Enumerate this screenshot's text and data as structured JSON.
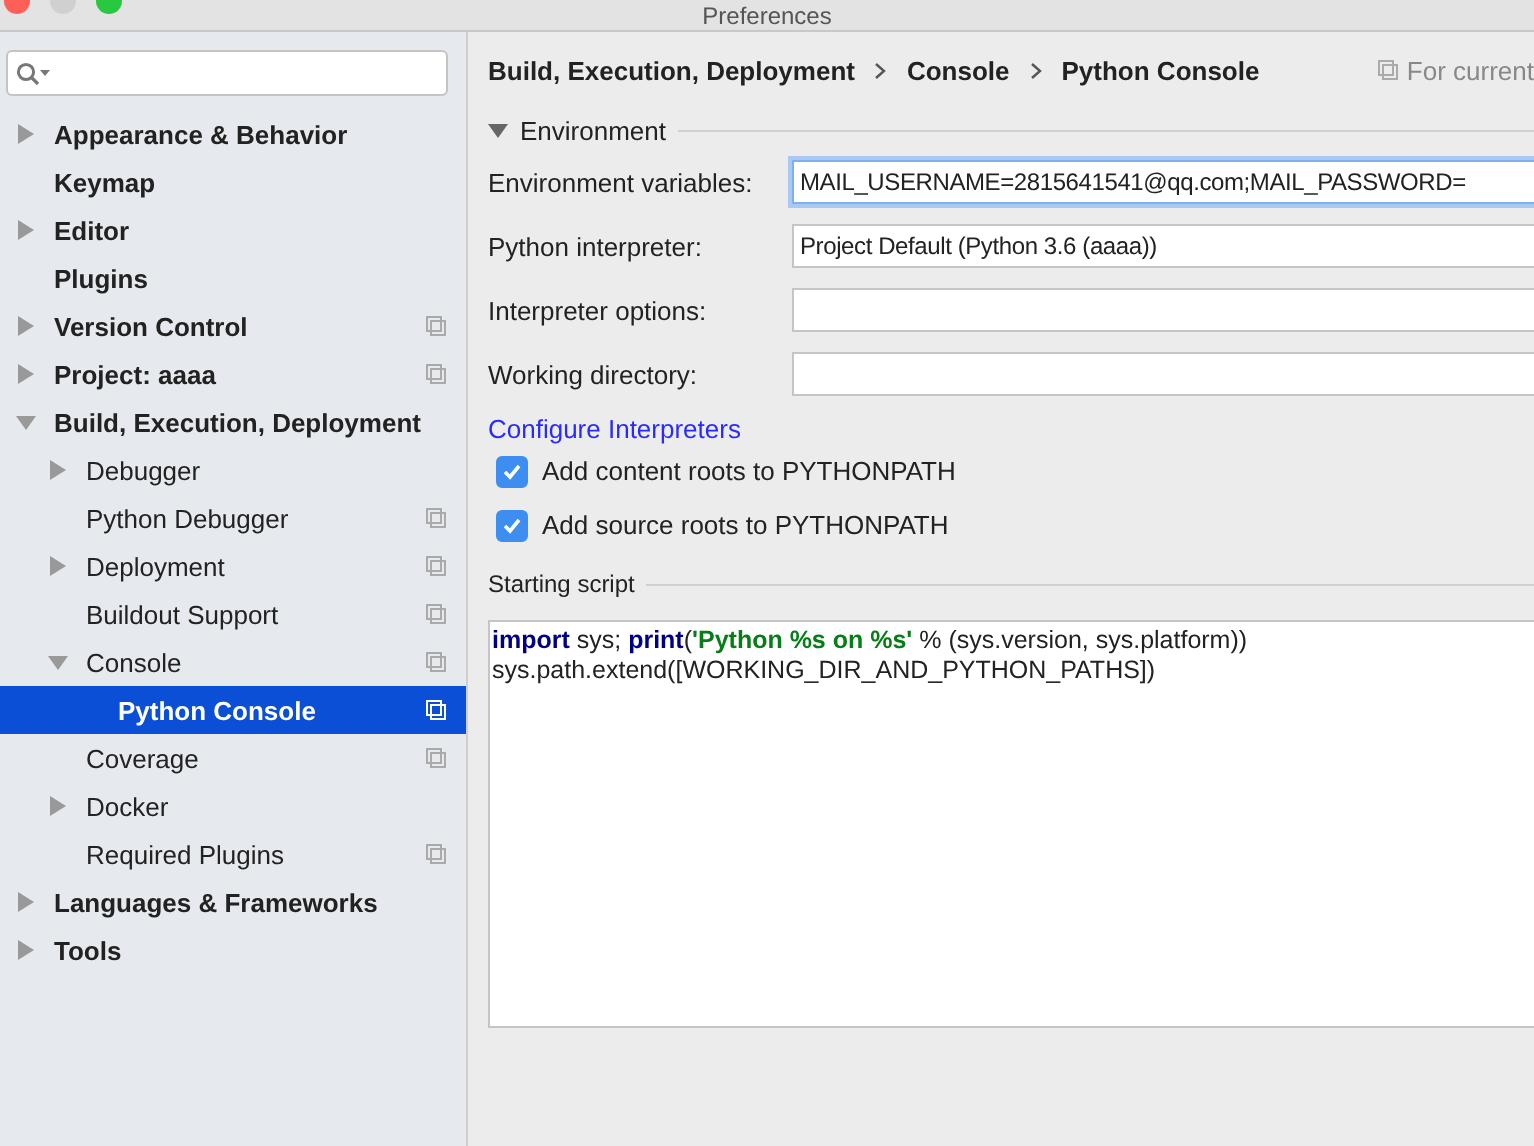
{
  "window": {
    "title": "Preferences"
  },
  "sidebar": {
    "items": [
      {
        "label": "Appearance & Behavior",
        "kind": "folder",
        "expanded": false,
        "selected": false,
        "project_level": false
      },
      {
        "label": "Keymap",
        "kind": "leaf",
        "selected": false,
        "project_level": false
      },
      {
        "label": "Editor",
        "kind": "folder",
        "expanded": false,
        "selected": false,
        "project_level": false
      },
      {
        "label": "Plugins",
        "kind": "leaf",
        "selected": false,
        "project_level": false
      },
      {
        "label": "Version Control",
        "kind": "folder",
        "expanded": false,
        "selected": false,
        "project_level": true
      },
      {
        "label": "Project: aaaa",
        "kind": "folder",
        "expanded": false,
        "selected": false,
        "project_level": true
      },
      {
        "label": "Build, Execution, Deployment",
        "kind": "folder",
        "expanded": true,
        "selected": false,
        "project_level": false,
        "children": [
          {
            "label": "Debugger",
            "kind": "folder",
            "expanded": false,
            "selected": false,
            "project_level": false
          },
          {
            "label": "Python Debugger",
            "kind": "leaf",
            "selected": false,
            "project_level": true
          },
          {
            "label": "Deployment",
            "kind": "folder",
            "expanded": false,
            "selected": false,
            "project_level": true
          },
          {
            "label": "Buildout Support",
            "kind": "leaf",
            "selected": false,
            "project_level": true
          },
          {
            "label": "Console",
            "kind": "folder",
            "expanded": true,
            "selected": false,
            "project_level": true,
            "children": [
              {
                "label": "Python Console",
                "kind": "leaf",
                "selected": true,
                "project_level": true
              }
            ]
          },
          {
            "label": "Coverage",
            "kind": "leaf",
            "selected": false,
            "project_level": true
          },
          {
            "label": "Docker",
            "kind": "folder",
            "expanded": false,
            "selected": false,
            "project_level": false
          },
          {
            "label": "Required Plugins",
            "kind": "leaf",
            "selected": false,
            "project_level": true
          }
        ]
      },
      {
        "label": "Languages & Frameworks",
        "kind": "folder",
        "expanded": false,
        "selected": false,
        "project_level": false
      },
      {
        "label": "Tools",
        "kind": "folder",
        "expanded": false,
        "selected": false,
        "project_level": false
      }
    ]
  },
  "breadcrumb": [
    "Build, Execution, Deployment",
    "Console",
    "Python Console"
  ],
  "scope_note": "For current",
  "environment": {
    "title": "Environment",
    "expanded": true,
    "fields": [
      {
        "label": "Environment variables:",
        "value": "MAIL_USERNAME=2815641541@qq.com;MAIL_PASSWORD=",
        "focused": true
      },
      {
        "label": "Python interpreter:",
        "value": "Project Default (Python 3.6 (aaaa))",
        "focused": false
      },
      {
        "label": "Interpreter options:",
        "focused": false
      },
      {
        "label": "Working directory:",
        "focused": false
      }
    ],
    "link": "Configure Interpreters",
    "checkboxes": [
      {
        "label": "Add content roots to PYTHONPATH",
        "checked": true
      },
      {
        "label": "Add source roots to PYTHONPATH",
        "checked": true
      }
    ]
  },
  "starting_script": {
    "title": "Starting script",
    "lines": [
      [
        {
          "kind": "keyword",
          "text": "import"
        },
        {
          "kind": "plain",
          "text": " sys; "
        },
        {
          "kind": "keyword",
          "text": "print"
        },
        {
          "kind": "plain",
          "text": "("
        },
        {
          "kind": "string",
          "text": "'Python %s on %s'"
        },
        {
          "kind": "plain",
          "text": " % (sys.version, sys.platform))"
        }
      ],
      [
        {
          "kind": "plain",
          "text": "sys.path.extend([WORKING_DIR_AND_PYTHON_PATHS])"
        }
      ]
    ]
  }
}
